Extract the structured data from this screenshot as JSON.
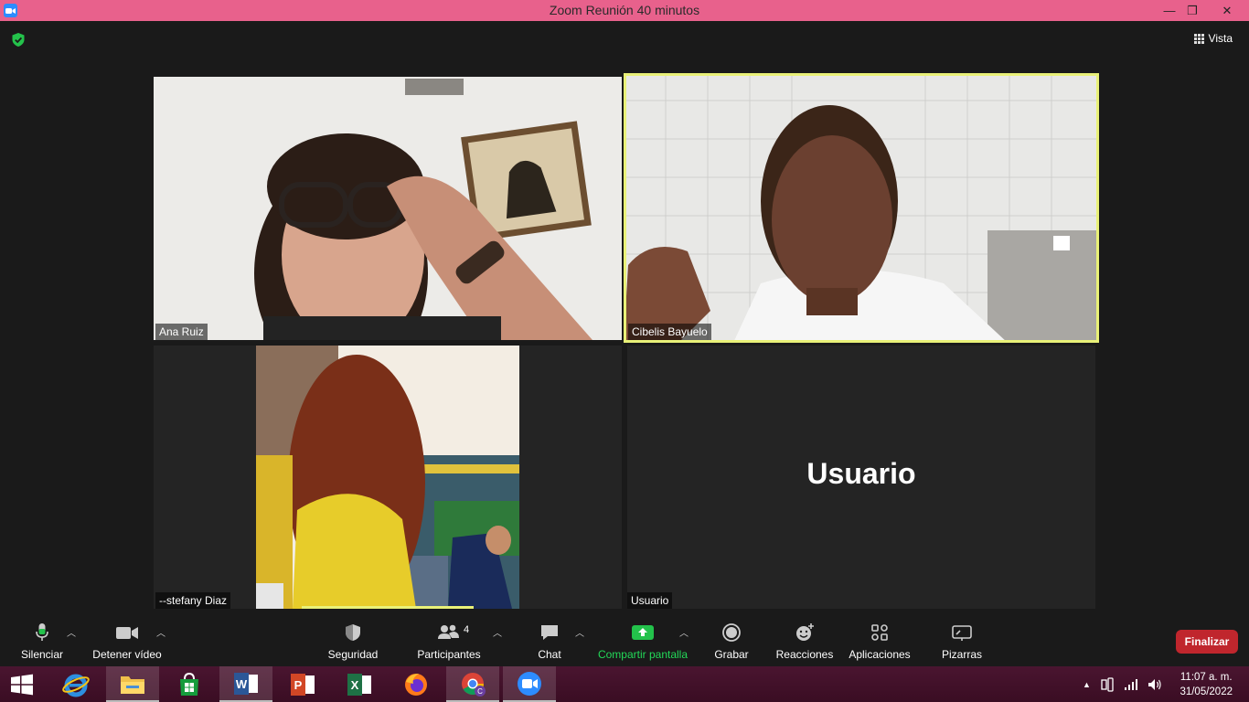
{
  "window": {
    "title": "Zoom Reunión 40 minutos",
    "minimize": "—",
    "maximize": "❐",
    "close": "✕"
  },
  "header": {
    "view_label": "Vista"
  },
  "participants": [
    {
      "name": "Ana Ruiz"
    },
    {
      "name": "Cibelis Bayuelo"
    },
    {
      "name": "--stefany Diaz"
    },
    {
      "name": "Usuario",
      "display": "Usuario"
    }
  ],
  "toolbar": {
    "mute": "Silenciar",
    "stop_video": "Detener vídeo",
    "security": "Seguridad",
    "participants": "Participantes",
    "participants_count": "4",
    "chat": "Chat",
    "share_screen": "Compartir pantalla",
    "record": "Grabar",
    "reactions": "Reacciones",
    "apps": "Aplicaciones",
    "whiteboards": "Pizarras",
    "end": "Finalizar"
  },
  "taskbar": {
    "time": "11:07 a. m.",
    "date": "31/05/2022"
  },
  "colors": {
    "title_bar": "#e8618c",
    "active_speaker": "#e9f178",
    "share_green": "#23d958",
    "end_red": "#c0262d",
    "taskbar": "#3f0f26"
  }
}
